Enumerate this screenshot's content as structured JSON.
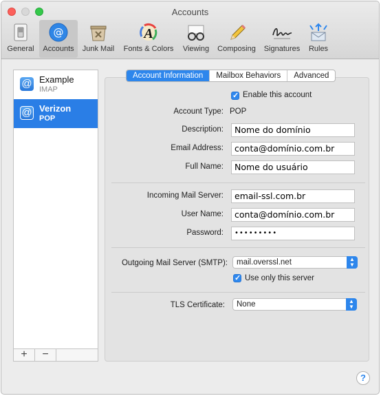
{
  "window": {
    "title": "Accounts"
  },
  "toolbar": {
    "items": [
      {
        "label": "General",
        "icon": "general-switch-icon"
      },
      {
        "label": "Accounts",
        "icon": "at-sign-icon",
        "selected": true
      },
      {
        "label": "Junk Mail",
        "icon": "junk-bin-icon"
      },
      {
        "label": "Fonts & Colors",
        "icon": "font-a-icon"
      },
      {
        "label": "Viewing",
        "icon": "glasses-icon"
      },
      {
        "label": "Composing",
        "icon": "pencil-icon"
      },
      {
        "label": "Signatures",
        "icon": "signature-icon"
      },
      {
        "label": "Rules",
        "icon": "rules-arrows-icon"
      }
    ]
  },
  "sidebar": {
    "accounts": [
      {
        "name": "Example",
        "type": "IMAP",
        "icon": "@"
      },
      {
        "name": "Verizon",
        "type": "POP",
        "icon": "@",
        "selected": true
      }
    ],
    "add_label": "+",
    "remove_label": "−"
  },
  "tabs": [
    {
      "label": "Account Information",
      "active": true
    },
    {
      "label": "Mailbox Behaviors"
    },
    {
      "label": "Advanced"
    }
  ],
  "form": {
    "enable_account_label": "Enable this account",
    "account_type_label": "Account Type:",
    "account_type_value": "POP",
    "description_label": "Description:",
    "description_value": "Nome do domínio",
    "email_label": "Email Address:",
    "email_value": "conta@domínio.com.br",
    "fullname_label": "Full Name:",
    "fullname_value": "Nome do usuário",
    "incoming_label": "Incoming Mail Server:",
    "incoming_value": "email-ssl.com.br",
    "username_label": "User Name:",
    "username_value": "conta@domínio.com.br",
    "password_label": "Password:",
    "password_value": "•••••••••",
    "smtp_label": "Outgoing Mail Server (SMTP):",
    "smtp_value": "mail.overssl.net",
    "use_only_label": "Use only this server",
    "tls_label": "TLS Certificate:",
    "tls_value": "None"
  },
  "help_label": "?",
  "colors": {
    "accent": "#2d86ec",
    "selection": "#2a7ee6"
  }
}
